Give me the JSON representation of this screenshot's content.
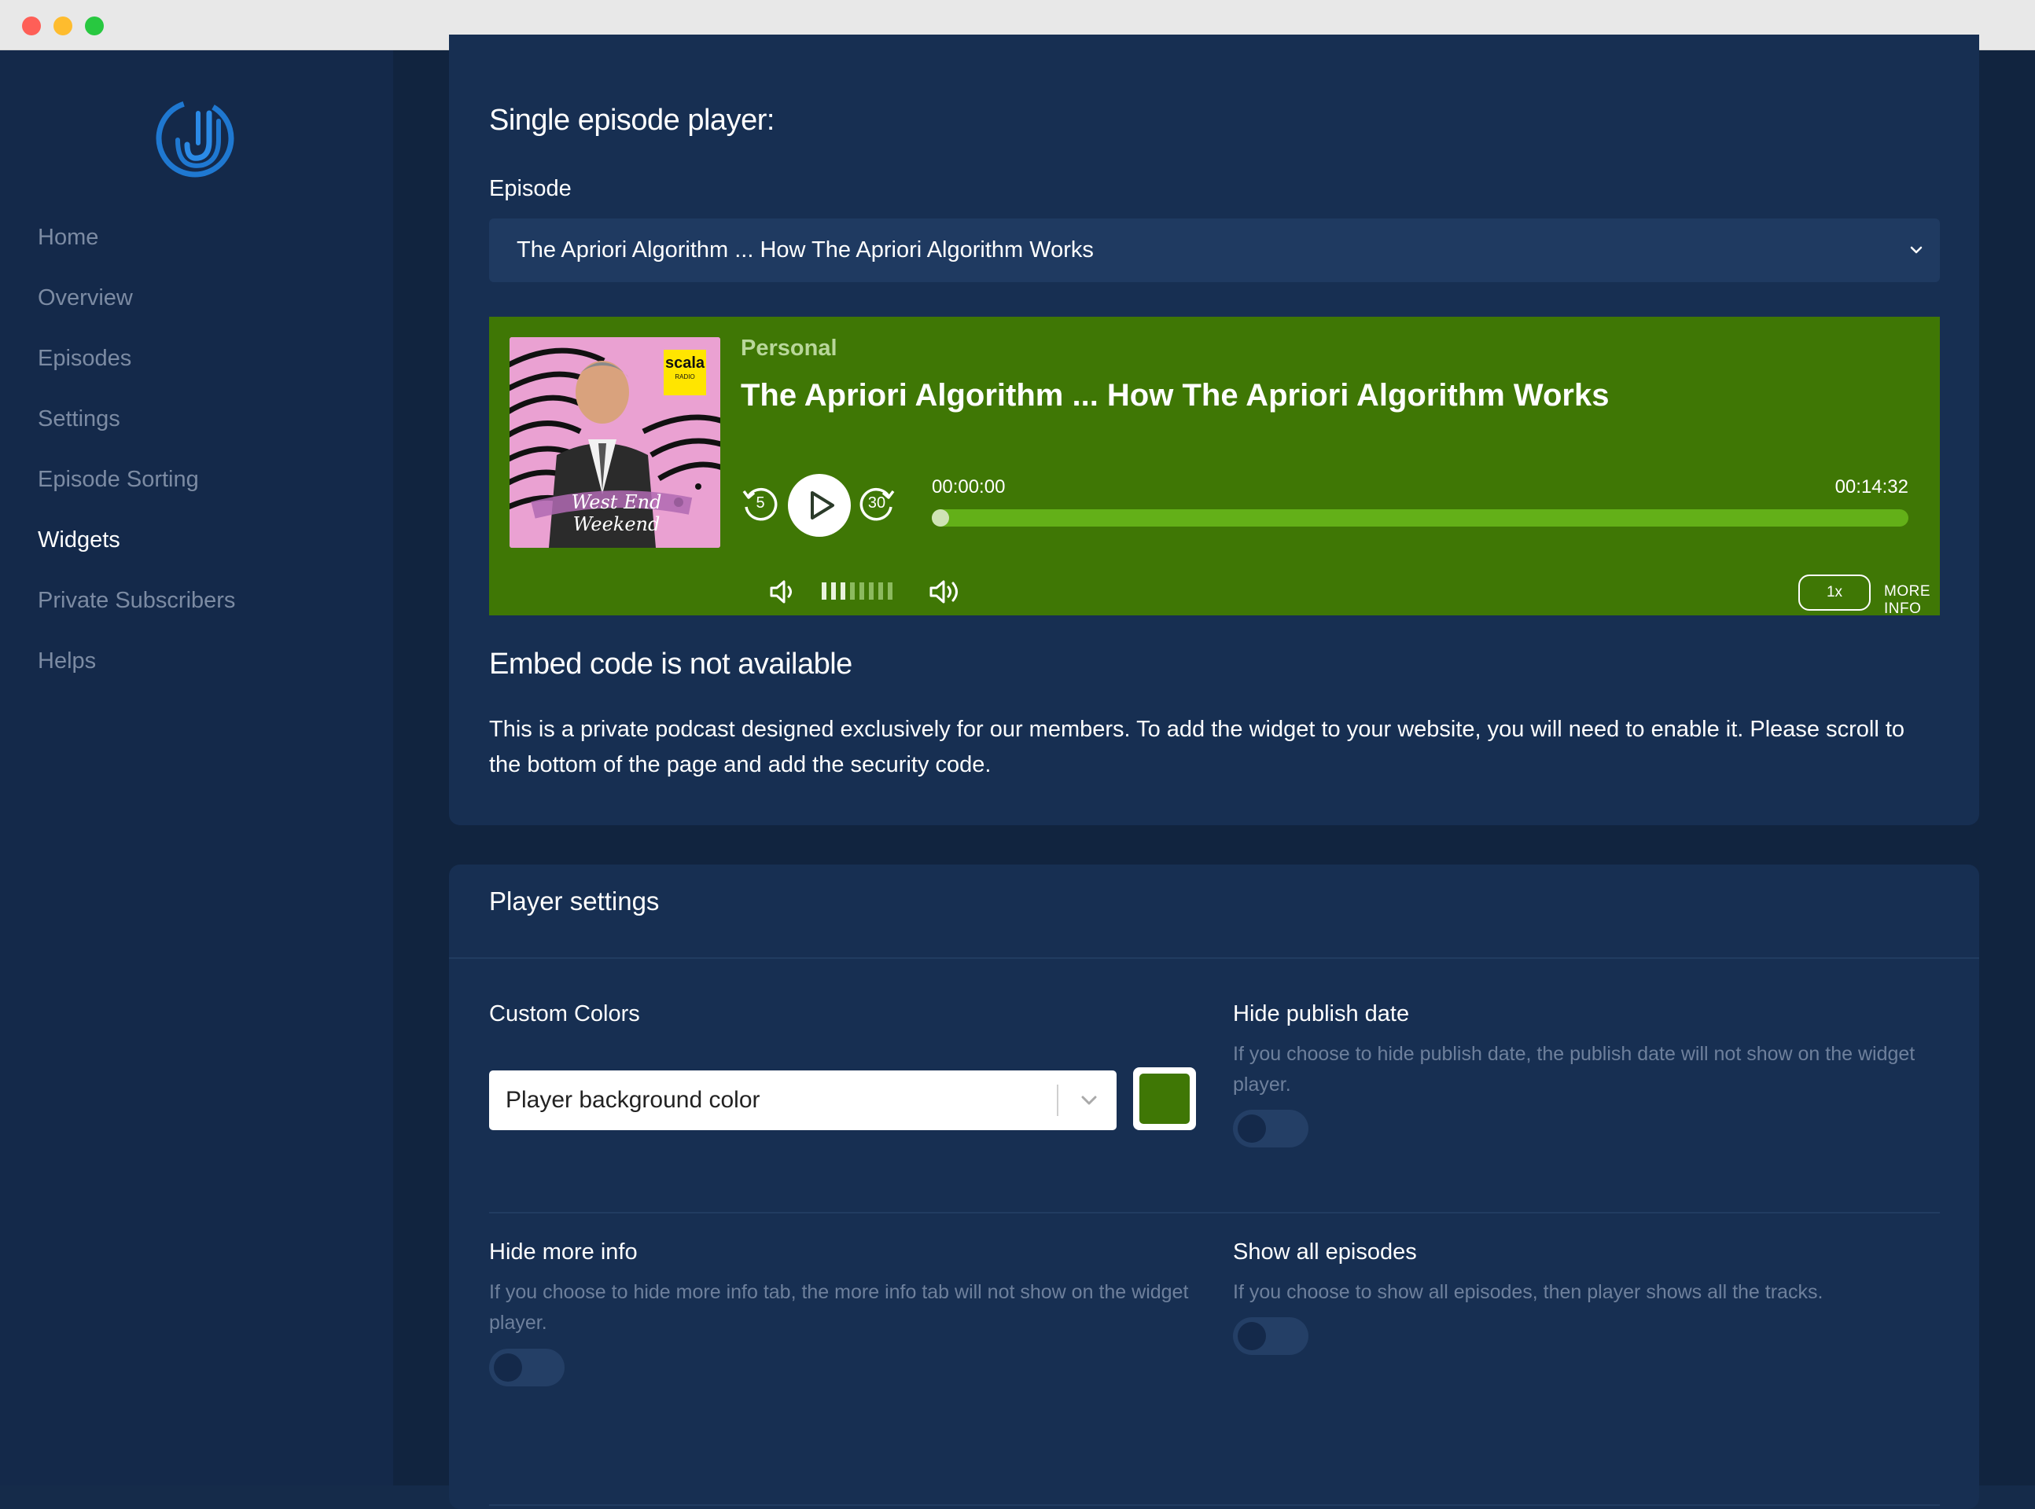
{
  "sidebar": {
    "logo_icon": "podcast-logo-icon",
    "items": [
      {
        "label": "Home",
        "active": false
      },
      {
        "label": "Overview",
        "active": false
      },
      {
        "label": "Episodes",
        "active": false
      },
      {
        "label": "Settings",
        "active": false
      },
      {
        "label": "Episode Sorting",
        "active": false
      },
      {
        "label": "Widgets",
        "active": true
      },
      {
        "label": "Private Subscribers",
        "active": false
      },
      {
        "label": "Helps",
        "active": false
      }
    ]
  },
  "single_player": {
    "heading": "Single episode player:",
    "episode_label": "Episode",
    "episode_selected": "The Apriori Algorithm ... How The Apriori Algorithm Works"
  },
  "player": {
    "category": "Personal",
    "title": "The Apriori Algorithm ... How The Apriori Algorithm Works",
    "cover_brand": "scala",
    "cover_brand_sub": "RADIO",
    "cover_caption": "West End Weekend",
    "rewind_seconds": "5",
    "forward_seconds": "30",
    "time_current": "00:00:00",
    "time_total": "00:14:32",
    "progress": 0,
    "volume_level": 0.3,
    "speed": "1x",
    "more_info": "MORE INFO",
    "background_color": "#3f7705"
  },
  "embed": {
    "heading": "Embed code is not available",
    "text": "This is a private podcast designed exclusively for our members. To add the widget to your website, you will need to enable it. Please scroll to the bottom of the page and add the security code."
  },
  "settings": {
    "heading": "Player settings",
    "custom_colors_label": "Custom Colors",
    "color_select_value": "Player background color",
    "color_swatch": "#3f7705",
    "hide_publish_date": {
      "label": "Hide publish date",
      "desc": "If you choose to hide publish date, the publish date will not show on the widget player.",
      "enabled": false
    },
    "hide_more_info": {
      "label": "Hide more info",
      "desc": "If you choose to hide more info tab, the more info tab will not show on the widget player.",
      "enabled": false
    },
    "show_all_episodes": {
      "label": "Show all episodes",
      "desc": "If you choose to show all episodes, then player shows all the tracks.",
      "enabled": false
    }
  }
}
